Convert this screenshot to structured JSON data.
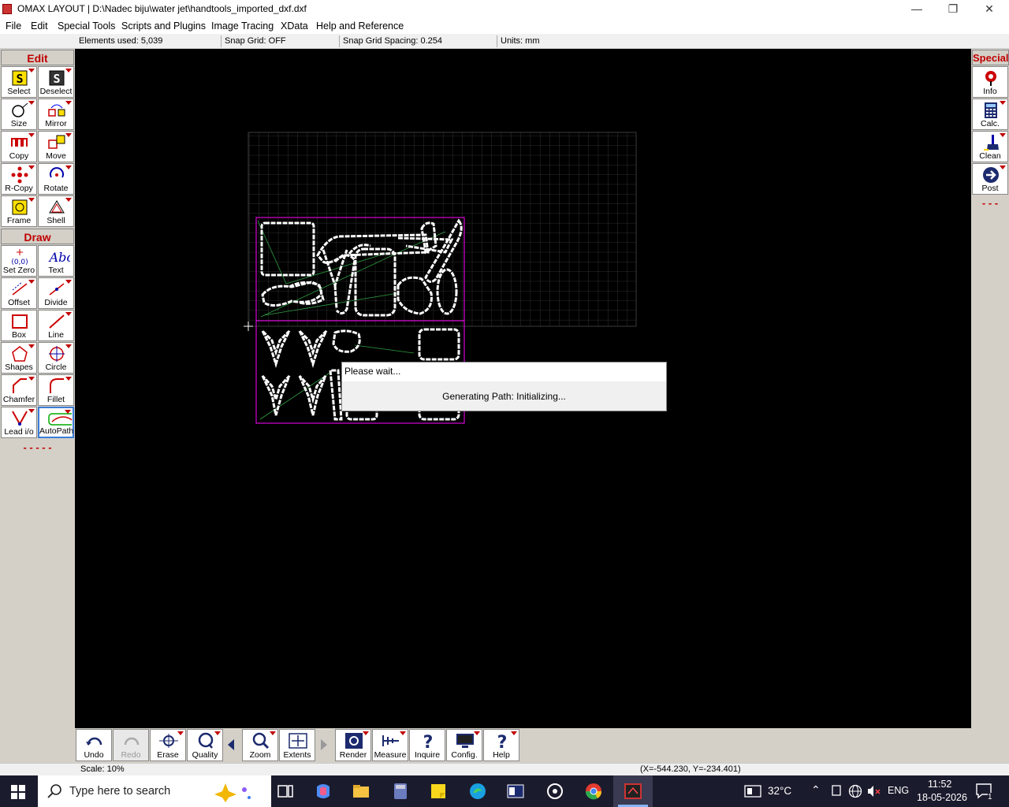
{
  "window": {
    "title": "OMAX LAYOUT | D:\\Nadec biju\\water jet\\handtools_imported_dxf.dxf"
  },
  "menu": [
    "File",
    "Edit",
    "Special Tools",
    "Scripts and Plugins",
    "Image Tracing",
    "XData",
    "Help and Reference"
  ],
  "status_top": {
    "elements": "Elements used: 5,039",
    "snap_grid": "Snap Grid: OFF",
    "snap_spacing": "Snap Grid Spacing: 0.254",
    "units": "Units: mm"
  },
  "left_toolbar": {
    "edit_header": "Edit",
    "draw_header": "Draw",
    "edit_buttons": [
      "Select",
      "Deselect",
      "Size",
      "Mirror",
      "Copy",
      "Move",
      "R-Copy",
      "Rotate",
      "Frame",
      "Shell"
    ],
    "draw_buttons": [
      "Set Zero",
      "Text",
      "Offset",
      "Divide",
      "Box",
      "Line",
      "Shapes",
      "Circle",
      "Chamfer",
      "Fillet",
      "Lead i/o",
      "AutoPath"
    ],
    "more": "- - - - -"
  },
  "right_toolbar": {
    "header": "Special",
    "buttons": [
      "Info",
      "Calc.",
      "Clean",
      "Post"
    ],
    "more": "- - -"
  },
  "bottom_toolbar": {
    "buttons": [
      "Undo",
      "Redo",
      "Erase",
      "Quality",
      "Zoom",
      "Extents",
      "Render",
      "Measure",
      "Inquire",
      "Config.",
      "Help"
    ]
  },
  "dialog": {
    "title": "Please wait...",
    "message": "Generating Path: Initializing..."
  },
  "status_bottom": {
    "scale": "Scale: 10%",
    "coords": "(X=-544.230, Y=-234.401)"
  },
  "taskbar": {
    "search_placeholder": "Type here to search",
    "temperature": "32°C",
    "language": "ENG",
    "time": "11:52",
    "date": "18-05-2026",
    "notifications": "1"
  },
  "colors": {
    "accent_red": "#c00000",
    "toolbar_gray": "#d4d0c8",
    "canvas_bg": "#000000",
    "selection_magenta": "#ff00ff"
  }
}
